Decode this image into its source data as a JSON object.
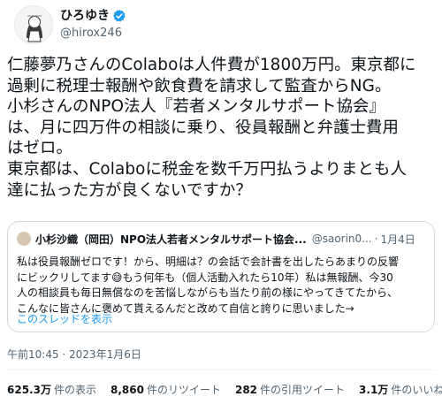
{
  "author": {
    "name": "ひろゆき",
    "handle": "@hirox246",
    "verified_color": "#1d9bf0"
  },
  "tweet": {
    "lines": [
      "仁藤夢乃さんのColaboは人件費が1800万円。東京都に",
      "過剰に税理士報酬や飲食費を請求して監査からNG。",
      "小杉さんのNPO法人『若者メンタルサポート協会』",
      "は、月に四万件の相談に乗り、役員報酬と弁護士費用",
      "はゼロ。",
      "東京都は、Colaboに税金を数千万円払うよりまとも人",
      "達に払った方が良くないですか？"
    ],
    "timestamp": "午前10:45 · 2023年1月6日"
  },
  "quote": {
    "name": "小杉沙織（岡田）NPO法人若者メンタルサポート協会...",
    "handle": "@saorin0...",
    "dot": "·",
    "date": "1月4日",
    "lines": [
      "私は役員報酬ゼロです！から、明細は？の会話で会計書を出したらあまりの反響",
      "にビックリしてます😅もう何年も（個人活動入れたら10年）私は無報酬、今30",
      "人の相談員も毎日無償なのを苦悩しながらも当たり前の様にやってきてたから、",
      "こんなに皆さんに褒めて貰えるんだと改めて自信と誇りに思いました→"
    ],
    "thread_link": "このスレッドを表示"
  },
  "stats": [
    {
      "value": "625.3万",
      "label": "件の表示"
    },
    {
      "value": "8,860",
      "label": "件のリツイート"
    },
    {
      "value": "282",
      "label": "件の引用ツイート"
    },
    {
      "value": "3.1万",
      "label": "件のいいね"
    }
  ]
}
